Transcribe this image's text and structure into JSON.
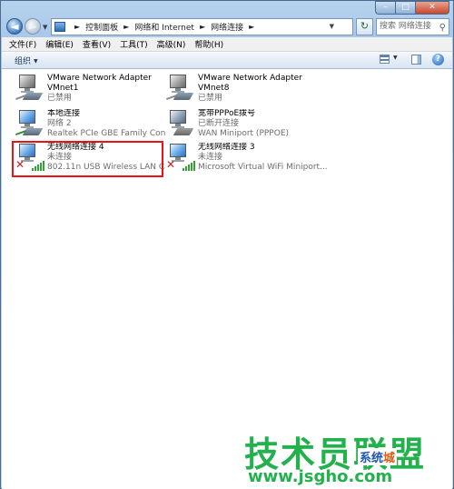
{
  "window": {
    "caption_buttons": {
      "minimize": "–",
      "maximize": "□",
      "close": "✕"
    }
  },
  "addressbar": {
    "back_glyph": "◄",
    "forward_glyph": "►",
    "breadcrumbs": [
      "控制面板",
      "网络和 Internet",
      "网络连接"
    ],
    "separator": "►",
    "search_placeholder": "搜索 网络连接",
    "refresh_glyph": "↻"
  },
  "menubar": {
    "items": [
      "文件(F)",
      "编辑(E)",
      "查看(V)",
      "工具(T)",
      "高级(N)",
      "帮助(H)"
    ]
  },
  "commandbar": {
    "organize_label": "组织",
    "help_glyph": "?"
  },
  "connections": [
    {
      "name": "VMware Network Adapter VMnet1",
      "name_line1": "VMware Network Adapter",
      "name_line2": "VMnet1",
      "status": "已禁用",
      "device": "",
      "type": "wired",
      "state": "disabled"
    },
    {
      "name": "VMware Network Adapter VMnet8",
      "name_line1": "VMware Network Adapter",
      "name_line2": "VMnet8",
      "status": "已禁用",
      "device": "",
      "type": "wired",
      "state": "disabled"
    },
    {
      "name": "本地连接",
      "status": "网络  2",
      "device": "Realtek PCIe GBE Family Contr...",
      "type": "wired",
      "state": "connected"
    },
    {
      "name": "宽带PPPoE拨号",
      "status": "已断开连接",
      "device": "WAN Miniport (PPPOE)",
      "type": "broadband",
      "state": "disconnected"
    },
    {
      "name": "无线网络连接 4",
      "status": "未连接",
      "device": "802.11n USB Wireless LAN Car...",
      "type": "wireless",
      "state": "not-connected"
    },
    {
      "name": "无线网络连接 3",
      "status": "未连接",
      "device": "Microsoft Virtual WiFi Miniport...",
      "type": "wireless",
      "state": "not-connected"
    }
  ],
  "watermark": {
    "text": "技术员联盟",
    "url": "www.jsgho.com",
    "corner_a": "系统",
    "corner_b": "城"
  },
  "colors": {
    "highlight": "#e5141b",
    "watermark": "#22b14c"
  }
}
